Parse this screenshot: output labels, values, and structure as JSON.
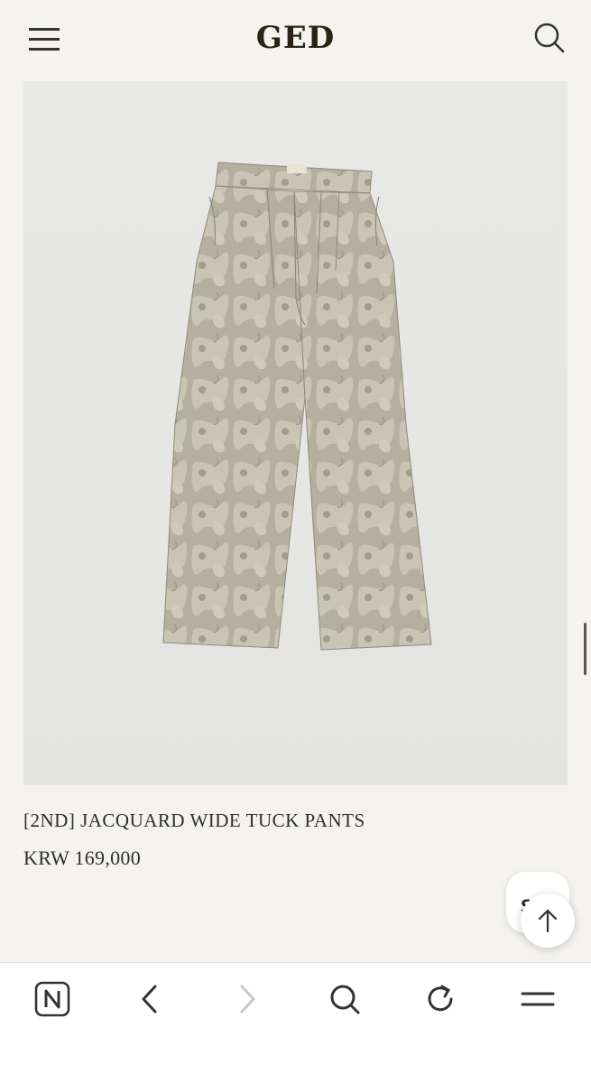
{
  "header": {
    "logo": "GED",
    "menu_icon": "hamburger-menu-icon",
    "search_icon": "search-icon"
  },
  "product": {
    "image_alt": "Jacquard wide tuck pants product photo",
    "name": "[2ND] JACQUARD WIDE TUCK PANTS",
    "price": "KRW 169,000"
  },
  "floating": {
    "chat_label": "S",
    "scroll_top_icon": "arrow-up-icon"
  },
  "browser_toolbar": {
    "items": [
      {
        "icon": "naver-logo-icon"
      },
      {
        "icon": "back-arrow-icon"
      },
      {
        "icon": "forward-arrow-icon"
      },
      {
        "icon": "search-icon"
      },
      {
        "icon": "refresh-icon"
      },
      {
        "icon": "menu-icon"
      }
    ]
  },
  "colors": {
    "background": "#f5f3f0",
    "image_bg": "#e6e6e3",
    "fabric": "#b2ad9c",
    "text": "#2e2e2e"
  }
}
